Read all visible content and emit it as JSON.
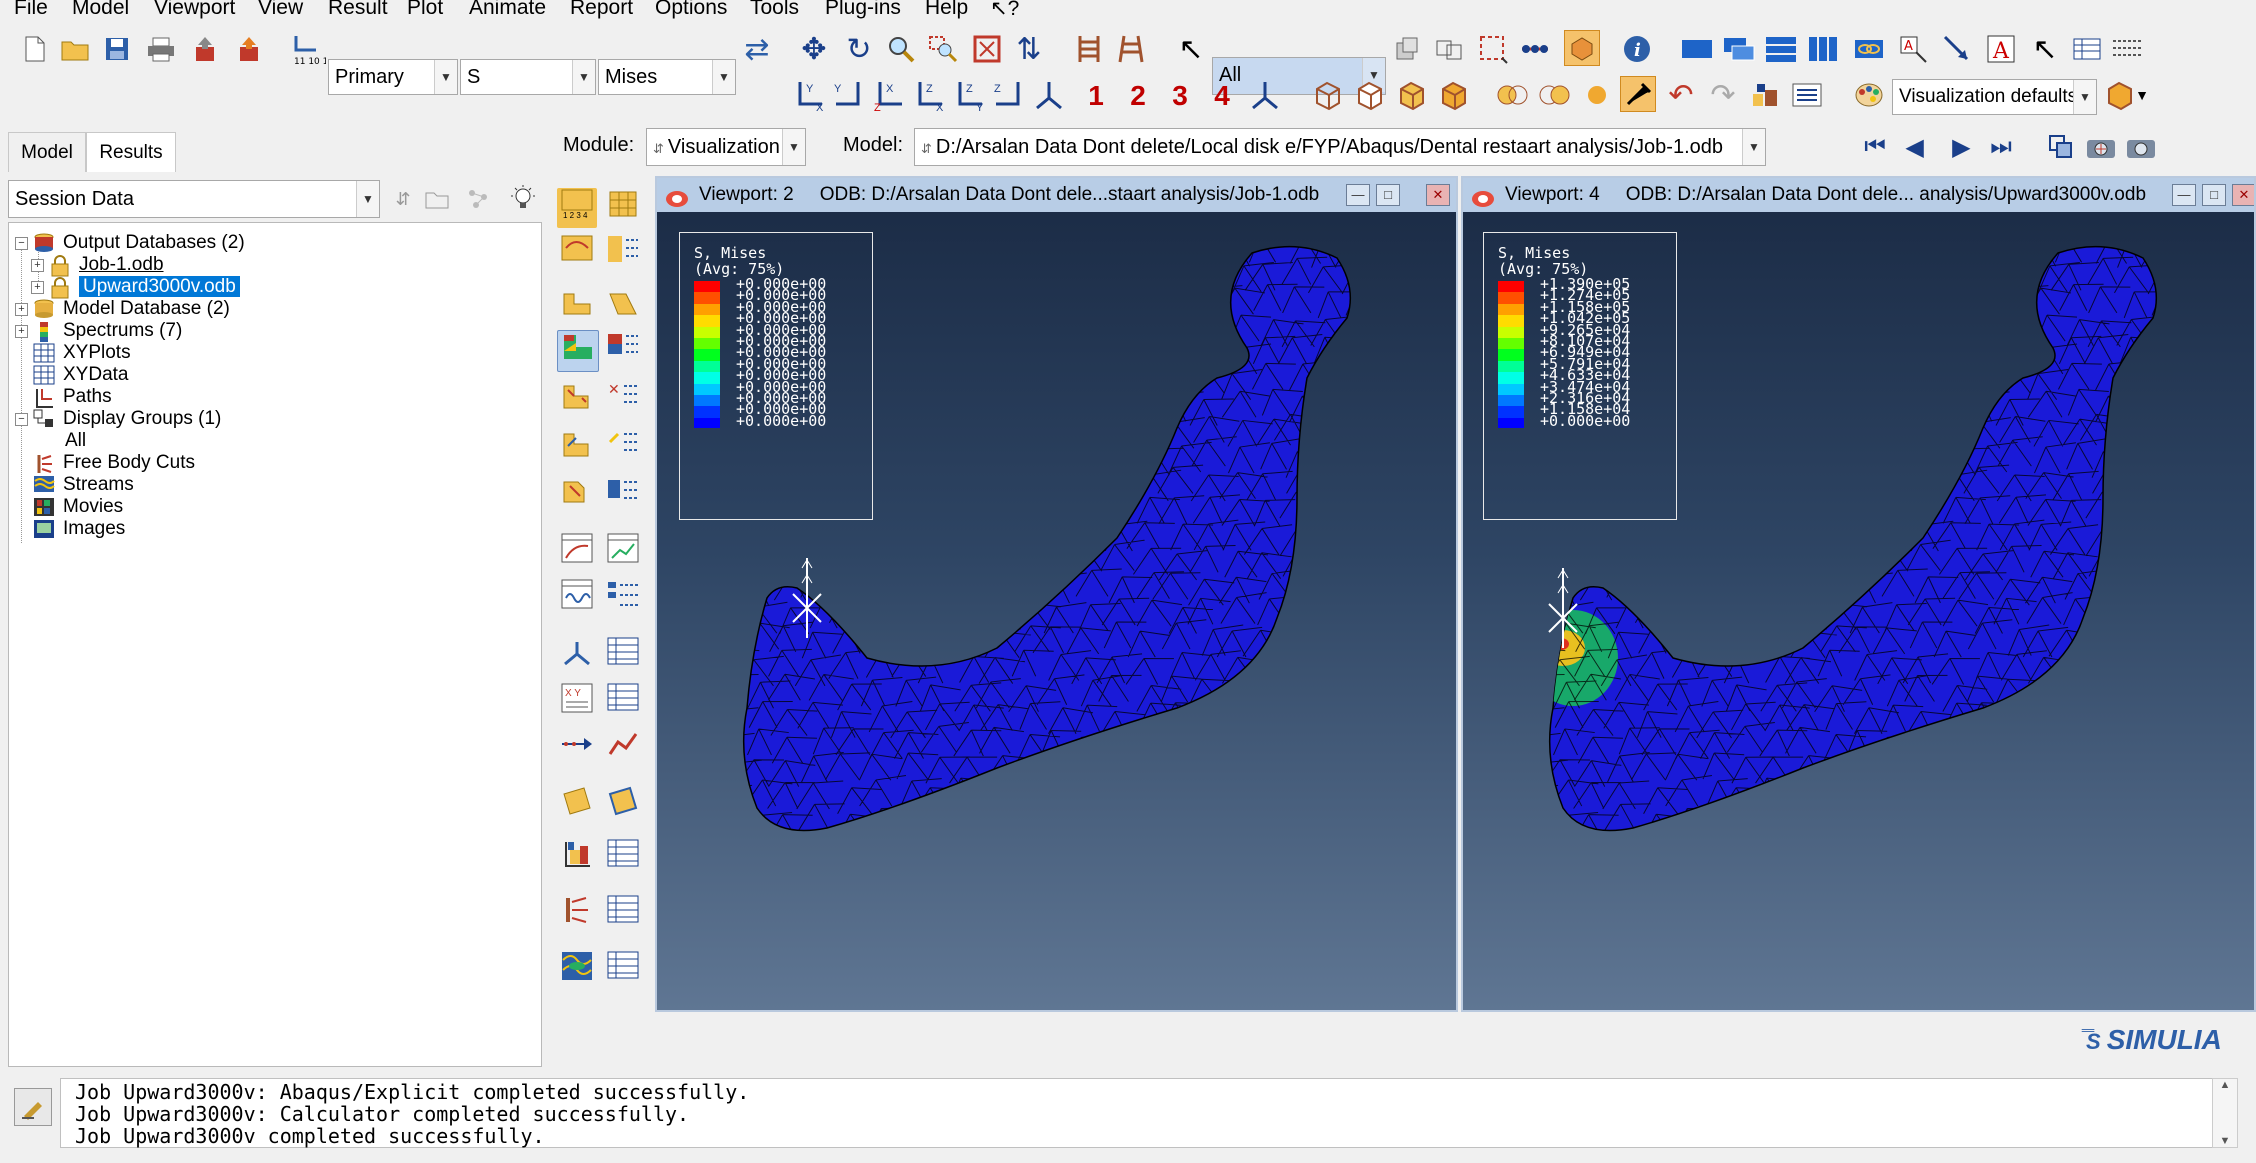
{
  "menu": [
    "File",
    "Model",
    "Viewport",
    "View",
    "Result",
    "Plot",
    "Animate",
    "Report",
    "Options",
    "Tools",
    "Plug-ins",
    "Help",
    "↖?"
  ],
  "toolbar": {
    "step_value": "Primary",
    "field_value": "S",
    "invariant_value": "Mises",
    "selection_filter": "All",
    "view_numbers": [
      "1",
      "2",
      "3",
      "4"
    ],
    "display_defaults": "Visualization defaults"
  },
  "context": {
    "module_label": "Module:",
    "module_value": "Visualization",
    "model_label": "Model:",
    "model_value": "D:/Arsalan Data Dont delete/Local disk e/FYP/Abaqus/Dental restaart analysis/Job-1.odb"
  },
  "left_panel": {
    "tabs": [
      "Model",
      "Results"
    ],
    "active_tab": "Results",
    "session_select": "Session Data",
    "tree": [
      {
        "label": "Output Databases (2)",
        "icon": "database-icon",
        "expander": "−"
      },
      {
        "label": "Job-1.odb",
        "icon": "lock-icon",
        "expander": "+"
      },
      {
        "label": "Upward3000v.odb",
        "icon": "lock-icon",
        "expander": "+",
        "selected": true
      },
      {
        "label": "Model Database (2)",
        "icon": "database-icon",
        "expander": "+"
      },
      {
        "label": "Spectrums (7)",
        "icon": "spectrum-icon",
        "expander": "+"
      },
      {
        "label": "XYPlots",
        "icon": "grid-icon",
        "expander": ""
      },
      {
        "label": "XYData",
        "icon": "grid-icon",
        "expander": ""
      },
      {
        "label": "Paths",
        "icon": "path-icon",
        "expander": ""
      },
      {
        "label": "Display Groups (1)",
        "icon": "display-group-icon",
        "expander": "−"
      },
      {
        "label": "All",
        "icon": "",
        "expander": ""
      },
      {
        "label": "Free Body Cuts",
        "icon": "free-body-cut-icon",
        "expander": ""
      },
      {
        "label": "Streams",
        "icon": "streams-icon",
        "expander": ""
      },
      {
        "label": "Movies",
        "icon": "movies-icon",
        "expander": ""
      },
      {
        "label": "Images",
        "icon": "images-icon",
        "expander": ""
      }
    ]
  },
  "viewports": [
    {
      "title": "Viewport: 2",
      "odb": "ODB: D:/Arsalan Data Dont dele...staart analysis/Job-1.odb",
      "legend_title": "S, Mises",
      "legend_avg": "(Avg: 75%)",
      "legend_values": [
        "+0.000e+00",
        "+0.000e+00",
        "+0.000e+00",
        "+0.000e+00",
        "+0.000e+00",
        "+0.000e+00",
        "+0.000e+00",
        "+0.000e+00",
        "+0.000e+00",
        "+0.000e+00",
        "+0.000e+00",
        "+0.000e+00",
        "+0.000e+00"
      ]
    },
    {
      "title": "Viewport: 4",
      "odb": "ODB: D:/Arsalan Data Dont dele... analysis/Upward3000v.odb",
      "legend_title": "S, Mises",
      "legend_avg": "(Avg: 75%)",
      "legend_values": [
        "+1.390e+05",
        "+1.274e+05",
        "+1.158e+05",
        "+1.042e+05",
        "+9.265e+04",
        "+8.107e+04",
        "+6.949e+04",
        "+5.791e+04",
        "+4.633e+04",
        "+3.474e+04",
        "+2.316e+04",
        "+1.158e+04",
        "+0.000e+00"
      ]
    }
  ],
  "legend_colors": [
    "#ff0000",
    "#ff5000",
    "#ffa000",
    "#ffdc00",
    "#c8ff00",
    "#64ff00",
    "#00ff1e",
    "#00ff96",
    "#00ffe6",
    "#00c8ff",
    "#0078ff",
    "#0032ff",
    "#0000ff"
  ],
  "brand": "SIMULIA",
  "messages": [
    "Job Upward3000v: Abaqus/Explicit completed successfully.",
    "Job Upward3000v: Calculator completed successfully.",
    "Job Upward3000v completed successfully."
  ]
}
